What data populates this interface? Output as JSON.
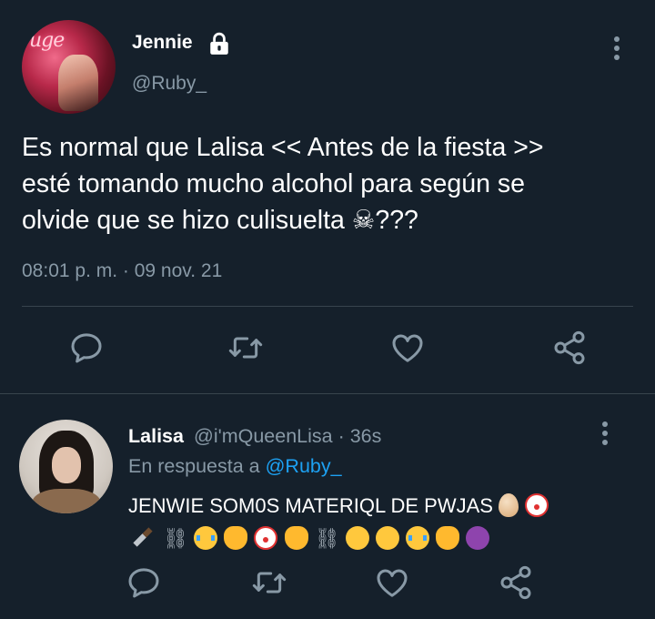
{
  "main_tweet": {
    "author_name": "Jennie",
    "handle": "@Ruby_",
    "text_lines": [
      "Es normal que Lalisa << Antes de la fiesta >>",
      "esté tomando mucho alcohol para según se",
      "olvide que se hizo culisuelta ☠???"
    ],
    "timestamp": "08:01 p. m. · 09 nov. 21",
    "icons": [
      "lock-icon",
      "more-vertical-icon",
      "reply-icon",
      "retweet-icon",
      "like-icon",
      "share-icon"
    ]
  },
  "reply_tweet": {
    "author_name": "Lalisa",
    "meta": "@i'mQueenLisa · 36s",
    "reply_prefix": "En respuesta a",
    "reply_mention": "@Ruby_",
    "text": "JENWIE SOM0S MATERIQL DE PWJAS",
    "emojis": [
      "egg",
      "clown-face",
      "knife",
      "chains",
      "crying-face",
      "cat",
      "clown-face",
      "cat",
      "chains",
      "pensive-face",
      "tired-face",
      "crying-face",
      "cat",
      "devil-face"
    ],
    "icons": [
      "more-vertical-icon",
      "reply-icon",
      "retweet-icon",
      "like-icon",
      "share-icon"
    ]
  },
  "colors": {
    "background": "#15202b",
    "text": "#ffffff",
    "muted": "#8899a6",
    "divider": "#38444d",
    "link": "#1da1f2"
  }
}
